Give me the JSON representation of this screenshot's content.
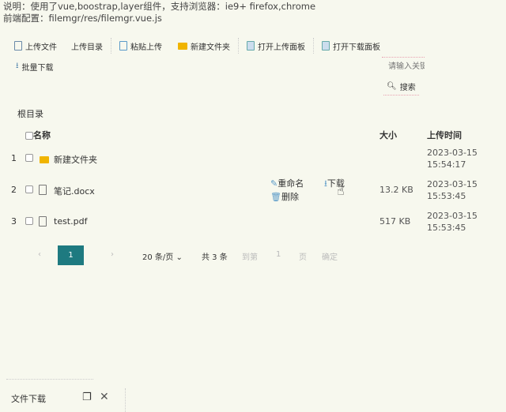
{
  "notes": [
    "说明：使用了vue,boostrap,layer组件，支持浏览器：ie9+ firefox,chrome",
    "前端配置：filemgr/res/filemgr.vue.js"
  ],
  "toolbar": {
    "upload_file": "上传文件",
    "upload_dir": "上传目录",
    "paste_upload": "粘贴上传",
    "new_folder": "新建文件夹",
    "open_upload_panel": "打开上传面板",
    "open_download_panel": "打开下载面板",
    "batch_download": "批量下载"
  },
  "search": {
    "placeholder": "请输入关键字",
    "button": "搜索"
  },
  "breadcrumb": "根目录",
  "table": {
    "headers": {
      "name": "名称",
      "size": "大小",
      "time": "上传时间"
    },
    "rows": [
      {
        "index": "1",
        "name": "新建文件夹",
        "type": "folder",
        "size": "",
        "date": "2023-03-15",
        "time": "15:54:17"
      },
      {
        "index": "2",
        "name": "笔记.docx",
        "type": "file",
        "size": "13.2 KB",
        "date": "2023-03-15",
        "time": "15:53:45"
      },
      {
        "index": "3",
        "name": "test.pdf",
        "type": "file",
        "size": "517 KB",
        "date": "2023-03-15",
        "time": "15:53:45"
      }
    ],
    "actions": {
      "rename": "重命名",
      "delete": "删除",
      "download": "下载"
    }
  },
  "pagination": {
    "current": "1",
    "page_size": "20 条/页",
    "total": "共 3 条",
    "goto": "到第",
    "goto_value": "1",
    "page_unit": "页",
    "confirm": "确定",
    "accent": "#1e7a80"
  },
  "download_panel": {
    "title": "文件下载"
  }
}
